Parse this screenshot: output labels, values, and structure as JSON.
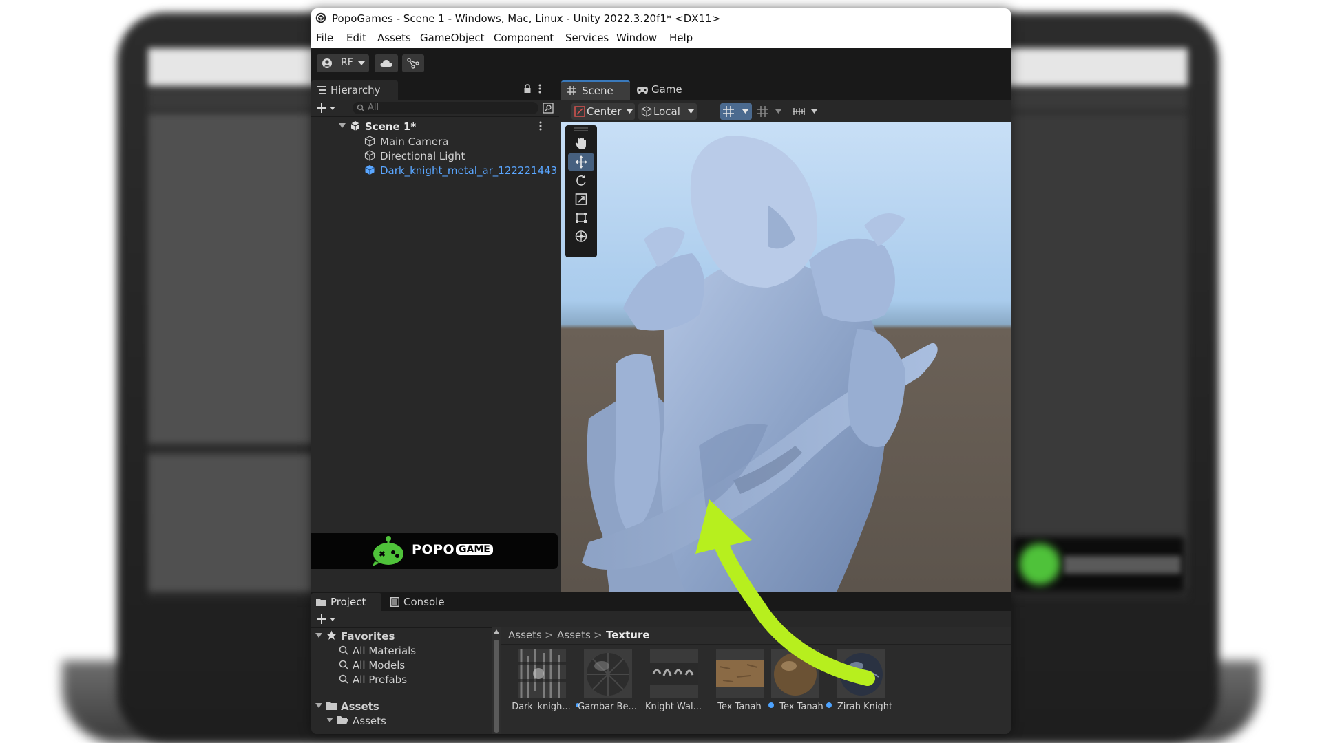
{
  "window": {
    "title": "PopoGames - Scene 1 - Windows, Mac, Linux - Unity 2022.3.20f1* <DX11>"
  },
  "menu": [
    "File",
    "Edit",
    "Assets",
    "GameObject",
    "Component",
    "Services",
    "Window",
    "Help"
  ],
  "toolbar": {
    "account_label": "RF"
  },
  "hierarchy": {
    "tab_label": "Hierarchy",
    "search_placeholder": "All",
    "scene_name": "Scene 1*",
    "items": [
      "Main Camera",
      "Directional Light",
      "Dark_knight_metal_ar_122221443"
    ]
  },
  "logo": {
    "text_main": "POPO",
    "text_badge": "GAME"
  },
  "scene": {
    "tabs": [
      "Scene",
      "Game"
    ],
    "pivot_label": "Center",
    "space_label": "Local"
  },
  "project": {
    "tabs": [
      "Project",
      "Console"
    ],
    "favorites_label": "Favorites",
    "favorites": [
      "All Materials",
      "All Models",
      "All Prefabs"
    ],
    "assets_root": "Assets",
    "assets_child": "Assets",
    "breadcrumb": [
      "Assets",
      "Assets",
      "Texture"
    ],
    "assets": [
      {
        "label": "Dark_knigh..."
      },
      {
        "label": "Gambar Be..."
      },
      {
        "label": "Knight Wal..."
      },
      {
        "label": "Tex Tanah"
      },
      {
        "label": "Tex Tanah"
      },
      {
        "label": "Zirah Knight"
      }
    ]
  },
  "colors": {
    "accent": "#3a79bb",
    "selected_text": "#5aa6ff",
    "arrow_green": "#b7ef1e",
    "unity_dark": "#282828"
  }
}
